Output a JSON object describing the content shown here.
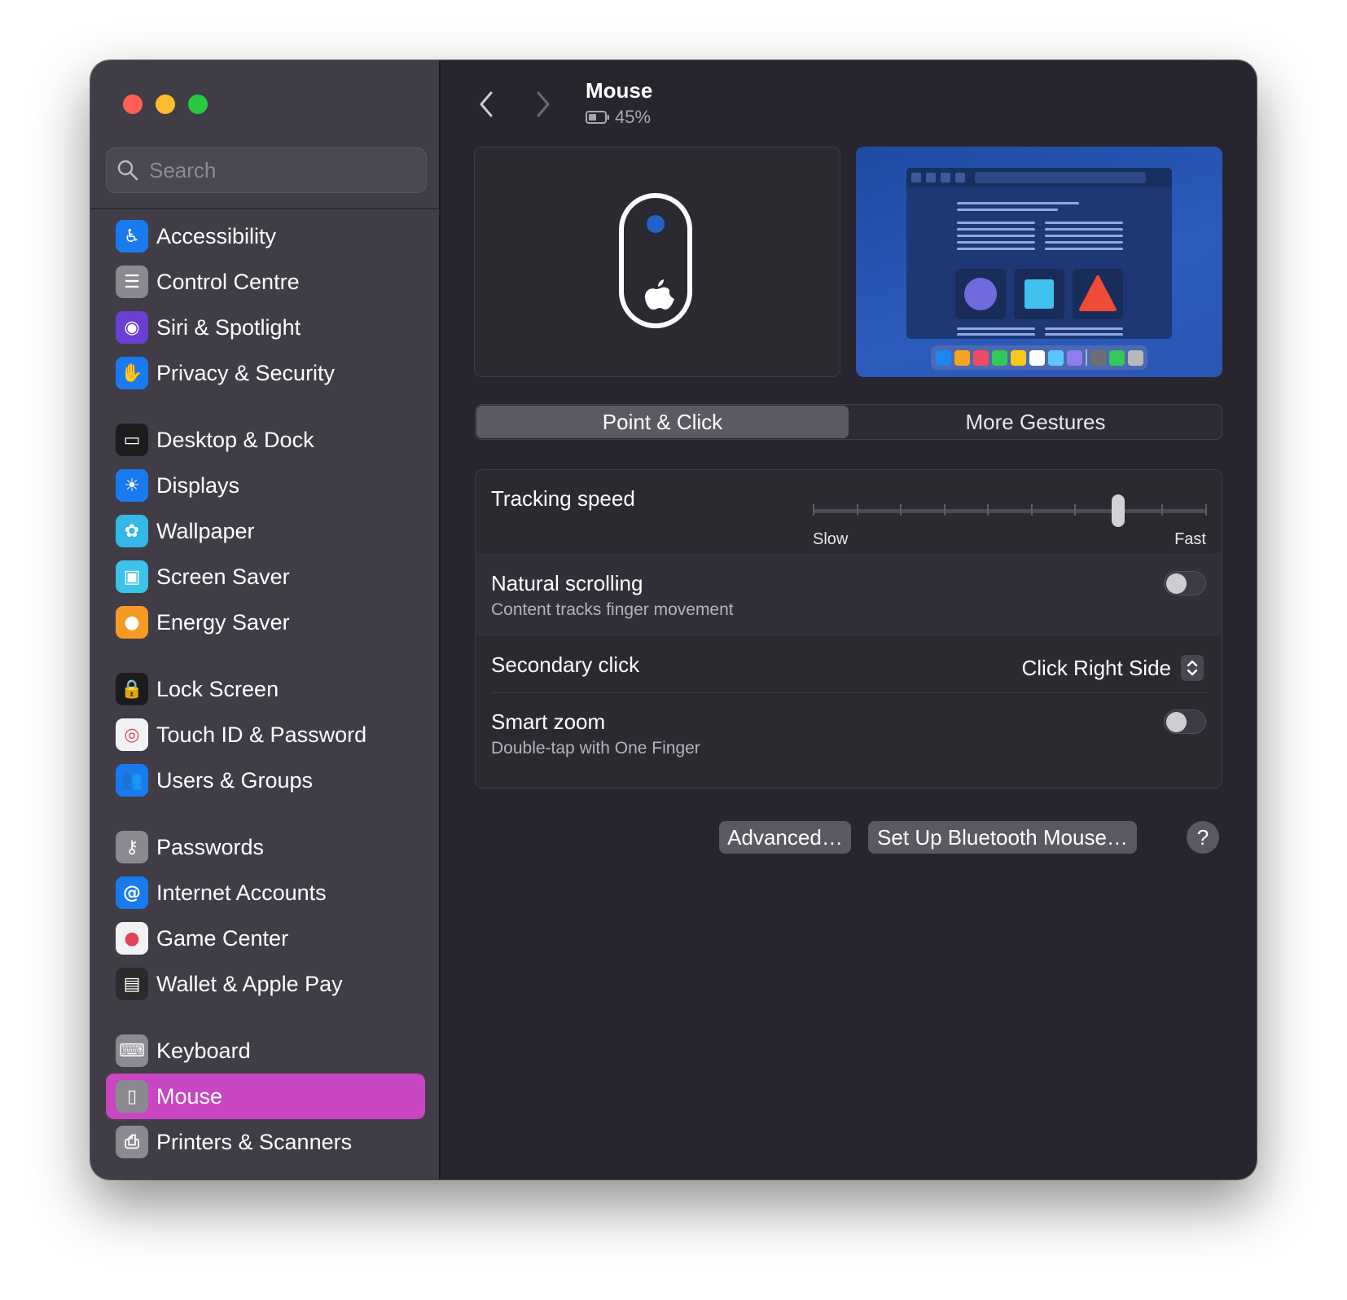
{
  "window": {
    "traffic_lights": [
      "close",
      "minimize",
      "zoom"
    ]
  },
  "search": {
    "placeholder": "Search"
  },
  "sidebar": {
    "items": [
      {
        "label": "Accessibility",
        "icon": "accessibility-icon",
        "color": "#1a7bf0",
        "glyph": "♿"
      },
      {
        "label": "Control Centre",
        "icon": "control-centre-icon",
        "color": "#8a8a90",
        "glyph": "☰"
      },
      {
        "label": "Siri & Spotlight",
        "icon": "siri-icon",
        "color": "#6b3fd1",
        "glyph": "◉"
      },
      {
        "label": "Privacy & Security",
        "icon": "hand-icon",
        "color": "#1a7bf0",
        "glyph": "✋"
      },
      {
        "label": "Desktop & Dock",
        "icon": "dock-icon",
        "color": "#1c1c1e",
        "glyph": "▭"
      },
      {
        "label": "Displays",
        "icon": "sun-icon",
        "color": "#1a7bf0",
        "glyph": "☀"
      },
      {
        "label": "Wallpaper",
        "icon": "flower-icon",
        "color": "#33b8e8",
        "glyph": "✿"
      },
      {
        "label": "Screen Saver",
        "icon": "screen-saver-icon",
        "color": "#3dc2e8",
        "glyph": "▣"
      },
      {
        "label": "Energy Saver",
        "icon": "bulb-icon",
        "color": "#f59a23",
        "glyph": "●"
      },
      {
        "label": "Lock Screen",
        "icon": "lock-icon",
        "color": "#1c1c1e",
        "glyph": "🔒"
      },
      {
        "label": "Touch ID & Password",
        "icon": "fingerprint-icon",
        "color": "#f2f2f5",
        "glyph": "◎"
      },
      {
        "label": "Users & Groups",
        "icon": "users-icon",
        "color": "#1a7bf0",
        "glyph": "👥"
      },
      {
        "label": "Passwords",
        "icon": "key-icon",
        "color": "#8a8a90",
        "glyph": "⚷"
      },
      {
        "label": "Internet Accounts",
        "icon": "at-icon",
        "color": "#1a7bf0",
        "glyph": "@"
      },
      {
        "label": "Game Center",
        "icon": "game-center-icon",
        "color": "#f2f2f5",
        "glyph": "●"
      },
      {
        "label": "Wallet & Apple Pay",
        "icon": "wallet-icon",
        "color": "#2b2b2e",
        "glyph": "▤"
      },
      {
        "label": "Keyboard",
        "icon": "keyboard-icon",
        "color": "#8a8a90",
        "glyph": "⌨"
      },
      {
        "label": "Mouse",
        "icon": "mouse-icon",
        "color": "#8a8a90",
        "glyph": "▯"
      },
      {
        "label": "Printers & Scanners",
        "icon": "printer-icon",
        "color": "#8a8a90",
        "glyph": "⎙"
      }
    ],
    "active_index": 17,
    "active_color": "#c946c3"
  },
  "header": {
    "title": "Mouse",
    "battery": "45%"
  },
  "tabs": [
    {
      "label": "Point & Click",
      "active": true
    },
    {
      "label": "More Gestures",
      "active": false
    }
  ],
  "settings": {
    "tracking_speed": {
      "label": "Tracking speed",
      "min_label": "Slow",
      "max_label": "Fast",
      "steps": 10,
      "value_step": 7
    },
    "natural_scrolling": {
      "label": "Natural scrolling",
      "sub": "Content tracks finger movement",
      "on": false
    },
    "secondary_click": {
      "label": "Secondary click",
      "value": "Click Right Side"
    },
    "smart_zoom": {
      "label": "Smart zoom",
      "sub": "Double-tap with One Finger",
      "on": false
    }
  },
  "buttons": {
    "advanced": "Advanced…",
    "bluetooth": "Set Up Bluetooth Mouse…",
    "help": "?"
  }
}
